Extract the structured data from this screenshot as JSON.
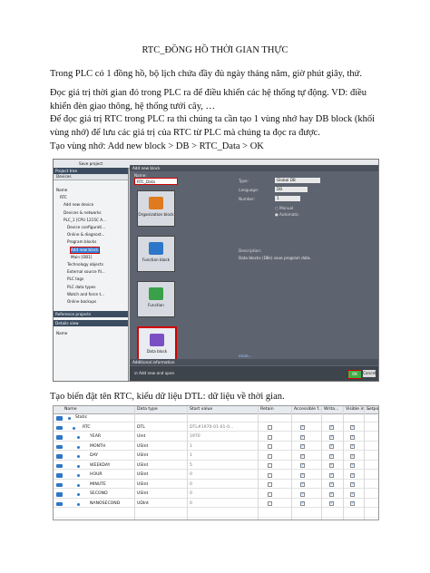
{
  "title": "RTC_ĐỒNG HỒ THỜI GIAN THỰC",
  "paragraphs": {
    "p1": "Trong PLC có 1 đồng hồ, bộ lịch chứa đầy đủ ngày tháng năm, giờ phút giây, thứ.",
    "p2": "Đọc giá trị thời gian đó trong PLC ra để điều khiển các hệ thống tự động. VD: điều khiển đèn giao thông, hệ thống tưới cây, …",
    "p3": "Để đọc giá trị RTC trong PLC ra thì chúng ta cần tạo 1 vùng nhớ hay DB block (khối vùng nhớ) để lưu các giá trị của RTC từ PLC mà chúng ta đọc ra được.",
    "p4": "Tạo vùng nhớ: Add new block > DB > RTC_Data > OK",
    "p5": "Tạo biến đặt tên RTC, kiểu dữ liệu DTL: dữ liệu về thời gian."
  },
  "shot1": {
    "toolbar_text": "Save project",
    "tree_title": "Project tree",
    "devices_tab": "Devices",
    "tree_items": [
      {
        "label": "Name",
        "indent": 0,
        "selected": false
      },
      {
        "label": "RTC",
        "indent": 1,
        "selected": false
      },
      {
        "label": "Add new device",
        "indent": 2,
        "selected": false
      },
      {
        "label": "Devices & networks",
        "indent": 2,
        "selected": false
      },
      {
        "label": "PLC_1 [CPU 1215C A...",
        "indent": 2,
        "selected": false
      },
      {
        "label": "Device configurati...",
        "indent": 3,
        "selected": false
      },
      {
        "label": "Online & diagnost...",
        "indent": 3,
        "selected": false
      },
      {
        "label": "Program blocks",
        "indent": 3,
        "selected": false
      },
      {
        "label": "Add new block",
        "indent": 4,
        "selected": true
      },
      {
        "label": "Main [OB1]",
        "indent": 4,
        "selected": false
      },
      {
        "label": "Technology objects",
        "indent": 3,
        "selected": false
      },
      {
        "label": "External source fil...",
        "indent": 3,
        "selected": false
      },
      {
        "label": "PLC tags",
        "indent": 3,
        "selected": false
      },
      {
        "label": "PLC data types",
        "indent": 3,
        "selected": false
      },
      {
        "label": "Watch and force t...",
        "indent": 3,
        "selected": false
      },
      {
        "label": "Online backups",
        "indent": 3,
        "selected": false
      }
    ],
    "reference_projects": "Reference projects",
    "details_view": "Details view",
    "details_name": "Name",
    "dialog_title": "Add new block",
    "name_label": "Name:",
    "name_value": "RTC_Data",
    "blocks": [
      {
        "label": "Organization block",
        "color": "#e07a1f",
        "selected": false
      },
      {
        "label": "Function block",
        "color": "#2d76c8",
        "selected": false
      },
      {
        "label": "Function",
        "color": "#3aa04a",
        "selected": false
      },
      {
        "label": "Data block",
        "color": "#7b4fc4",
        "selected": true
      }
    ],
    "type_label": "Type:",
    "type_value": "Global DB",
    "language_label": "Language:",
    "language_value": "DB",
    "number_label": "Number:",
    "number_value": "1",
    "manual_label": "Manual",
    "automatic_label": "Automatic",
    "description_label": "Description:",
    "description_text": "Data blocks (DBs) save program data.",
    "more_label": "more...",
    "additional_info": "Additional information",
    "add_new_open": "Add new and open",
    "ok_label": "OK",
    "cancel_label": "Cancel"
  },
  "shot2": {
    "headers": [
      "Name",
      "Data type",
      "Start value",
      "Retain",
      "Accessible f...",
      "Writa...",
      "Visible in ...",
      "Setpoint"
    ],
    "rows": [
      {
        "num": "1",
        "name": "Static",
        "type": "",
        "start": "",
        "level": 0,
        "checks": false
      },
      {
        "num": "2",
        "name": "RTC",
        "type": "DTL",
        "start": "DTL#1970-01-01-0...",
        "level": 1,
        "checks": true
      },
      {
        "num": "3",
        "name": "YEAR",
        "type": "UInt",
        "start": "1970",
        "level": 2,
        "checks": true
      },
      {
        "num": "4",
        "name": "MONTH",
        "type": "USInt",
        "start": "1",
        "level": 2,
        "checks": true
      },
      {
        "num": "5",
        "name": "DAY",
        "type": "USInt",
        "start": "1",
        "level": 2,
        "checks": true
      },
      {
        "num": "6",
        "name": "WEEKDAY",
        "type": "USInt",
        "start": "5",
        "level": 2,
        "checks": true
      },
      {
        "num": "7",
        "name": "HOUR",
        "type": "USInt",
        "start": "0",
        "level": 2,
        "checks": true
      },
      {
        "num": "8",
        "name": "MINUTE",
        "type": "USInt",
        "start": "0",
        "level": 2,
        "checks": true
      },
      {
        "num": "9",
        "name": "SECOND",
        "type": "USInt",
        "start": "0",
        "level": 2,
        "checks": true
      },
      {
        "num": "10",
        "name": "NANOSECOND",
        "type": "UDInt",
        "start": "0",
        "level": 2,
        "checks": true
      }
    ]
  }
}
